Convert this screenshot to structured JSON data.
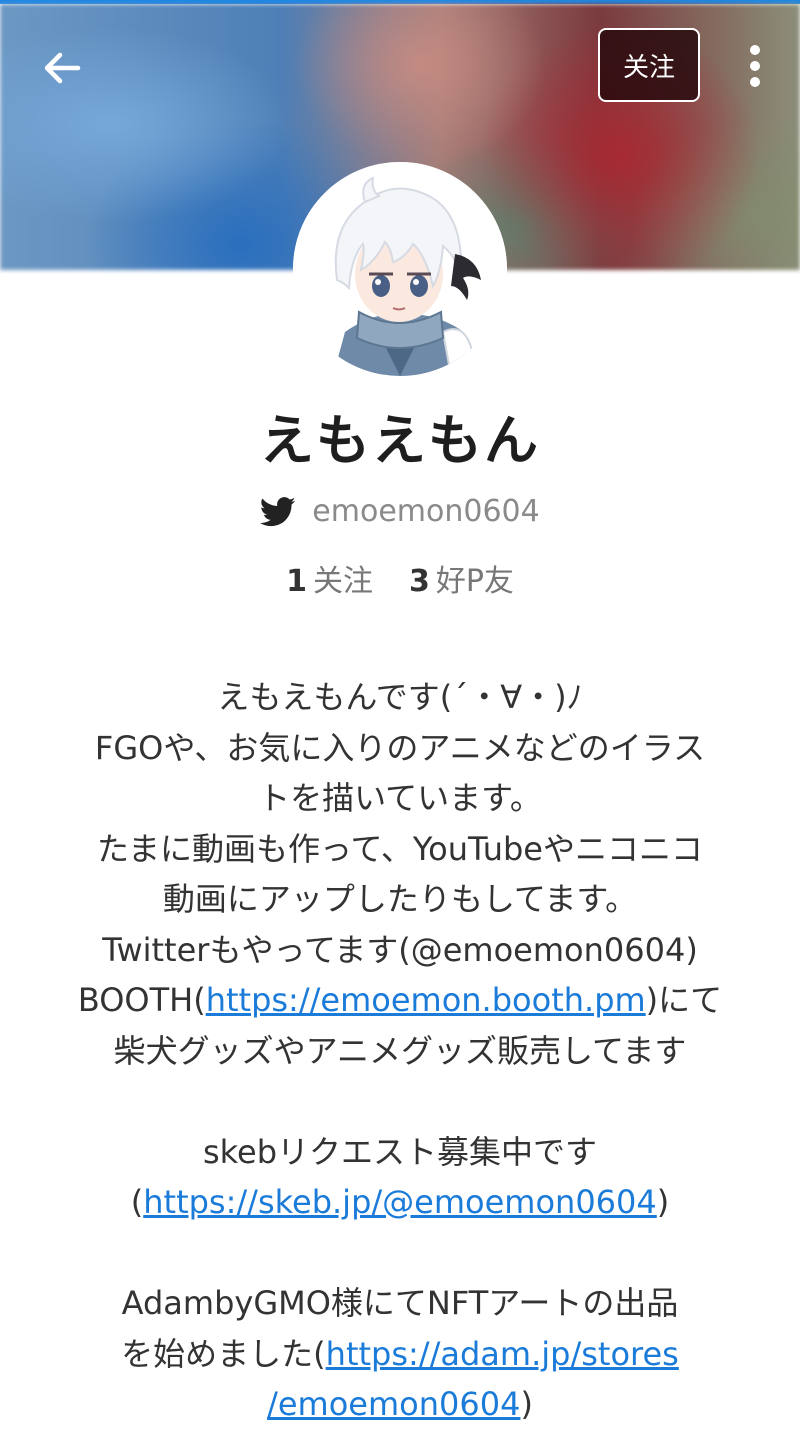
{
  "header": {
    "follow_label": "关注"
  },
  "profile": {
    "display_name": "えもえもん",
    "twitter_handle": "emoemon0604",
    "following_count": "1",
    "following_label": "关注",
    "friends_count": "3",
    "friends_label": "好P友"
  },
  "bio": {
    "line1": "えもえもんです(´・∀・)ﾉ",
    "line2": "FGOや、お気に入りのアニメなどのイラス",
    "line3": "トを描いています。",
    "line4": "たまに動画も作って、YouTubeやニコニコ",
    "line5": "動画にアップしたりもしてます。",
    "line6": "Twitterもやってます(@emoemon0604)",
    "line7_pre": "BOOTH(",
    "line7_link": "https://emoemon.booth.pm",
    "line7_post": ")にて",
    "line8": "柴犬グッズやアニメグッズ販売してます",
    "line9": "skebリクエスト募集中です",
    "line10_pre": "(",
    "line10_link": "https://skeb.jp/@emoemon0604",
    "line10_post": ")",
    "line11": "AdambyGMO様にてNFTアートの出品",
    "line12_pre": "を始めました(",
    "line12_link": "https://adam.jp/stores",
    "line13_link": "/emoemon0604",
    "line13_post": ")"
  },
  "colors": {
    "accent": "#1e88e5",
    "link": "#1b7bd9",
    "follow_button_bg": "#2a0a0e"
  },
  "icons": {
    "back": "arrow-left-icon",
    "more": "more-vertical-icon",
    "twitter": "twitter-bird-icon"
  }
}
